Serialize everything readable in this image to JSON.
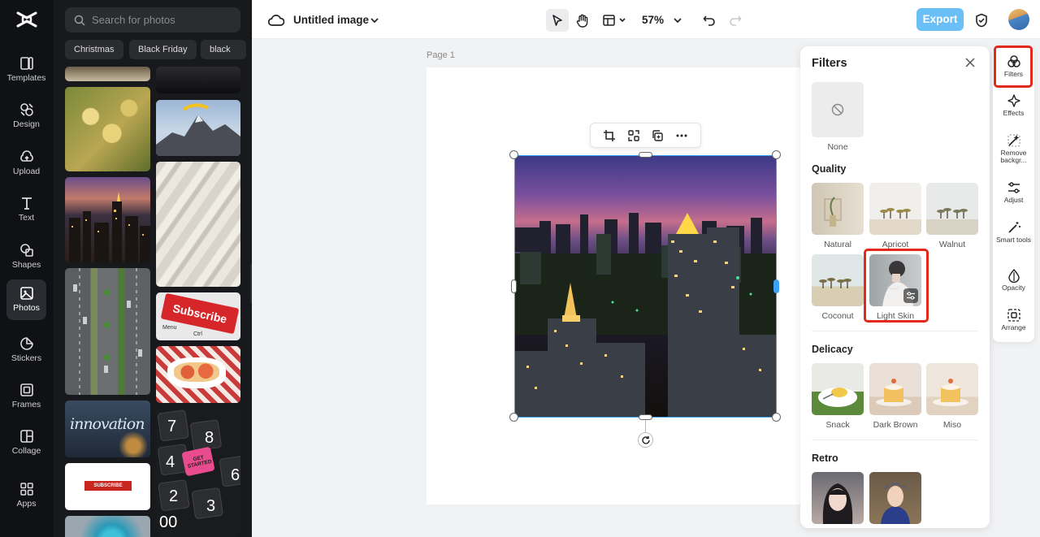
{
  "left_rail": {
    "items": [
      {
        "label": "Templates",
        "icon": "templates-icon"
      },
      {
        "label": "Design",
        "icon": "design-icon"
      },
      {
        "label": "Upload",
        "icon": "upload-icon"
      },
      {
        "label": "Text",
        "icon": "text-icon"
      },
      {
        "label": "Shapes",
        "icon": "shapes-icon"
      },
      {
        "label": "Photos",
        "icon": "photos-icon",
        "active": true
      },
      {
        "label": "Stickers",
        "icon": "stickers-icon"
      },
      {
        "label": "Frames",
        "icon": "frames-icon"
      },
      {
        "label": "Collage",
        "icon": "collage-icon"
      },
      {
        "label": "Apps",
        "icon": "apps-icon"
      }
    ]
  },
  "photos_panel": {
    "search_placeholder": "Search for photos",
    "chips": [
      "Christmas",
      "Black Friday",
      "black"
    ],
    "photo_texts": {
      "subscribe": "Subscribe",
      "menu": "Menu",
      "ctrl": "Ctrl",
      "innovation": "innovation",
      "get_started": "GET STARTED",
      "subscribe_small": "SUBSCRIBE"
    }
  },
  "topbar": {
    "title": "Untitled image",
    "zoom": "57%",
    "export_label": "Export"
  },
  "canvas": {
    "page_label": "Page 1"
  },
  "filters": {
    "title": "Filters",
    "none_label": "None",
    "sections": [
      {
        "title": "Quality",
        "items": [
          "Natural",
          "Apricot",
          "Walnut",
          "Coconut",
          "Light Skin"
        ]
      },
      {
        "title": "Delicacy",
        "items": [
          "Snack",
          "Dark Brown",
          "Miso"
        ]
      },
      {
        "title": "Retro",
        "items": [
          "",
          ""
        ]
      }
    ],
    "selected": "Light Skin"
  },
  "tool_rail": {
    "items": [
      {
        "label": "Filters",
        "icon": "filters-icon",
        "active": true
      },
      {
        "label": "Effects",
        "icon": "effects-icon"
      },
      {
        "label": "Remove backgr...",
        "icon": "remove-background-icon"
      },
      {
        "label": "Adjust",
        "icon": "adjust-icon"
      },
      {
        "label": "Smart tools",
        "icon": "smart-tools-icon"
      },
      {
        "label": "Opacity",
        "icon": "opacity-icon"
      },
      {
        "label": "Arrange",
        "icon": "arrange-icon"
      }
    ]
  },
  "colors": {
    "accent": "#69bff6",
    "selection": "#3aa1f5",
    "highlight": "#e3281c",
    "rail_bg": "#101114",
    "panel_bg": "#18191c"
  }
}
